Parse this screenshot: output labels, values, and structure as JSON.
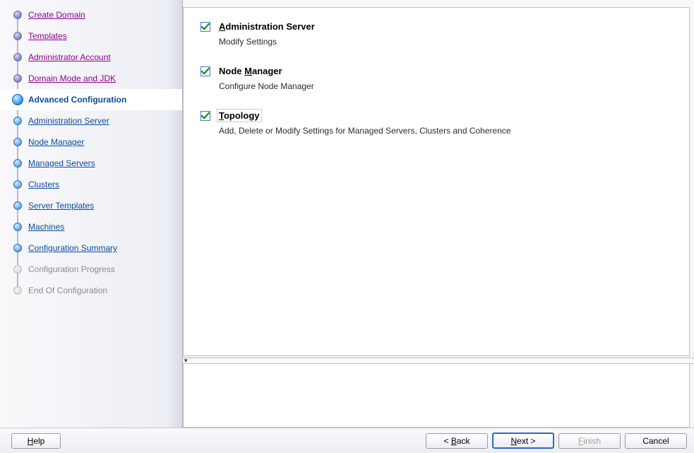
{
  "sidebar": {
    "items": [
      {
        "label": "Create Domain",
        "state": "visited",
        "interactable": true
      },
      {
        "label": "Templates",
        "state": "visited",
        "interactable": true
      },
      {
        "label": "Administrator Account",
        "state": "visited",
        "interactable": true
      },
      {
        "label": "Domain Mode and JDK",
        "state": "visited",
        "interactable": true
      },
      {
        "label": "Advanced Configuration",
        "state": "current",
        "interactable": true
      },
      {
        "label": "Administration Server",
        "state": "upcoming",
        "interactable": true
      },
      {
        "label": "Node Manager",
        "state": "upcoming",
        "interactable": true
      },
      {
        "label": "Managed Servers",
        "state": "upcoming",
        "interactable": true
      },
      {
        "label": "Clusters",
        "state": "upcoming",
        "interactable": true
      },
      {
        "label": "Server Templates",
        "state": "upcoming",
        "interactable": true
      },
      {
        "label": "Machines",
        "state": "upcoming",
        "interactable": true
      },
      {
        "label": "Configuration Summary",
        "state": "upcoming",
        "interactable": true
      },
      {
        "label": "Configuration Progress",
        "state": "future",
        "interactable": false
      },
      {
        "label": "End Of Configuration",
        "state": "future",
        "interactable": false
      }
    ]
  },
  "content": {
    "options": [
      {
        "key": "admin_server",
        "title_prefix": "A",
        "title_rest": "dministration Server",
        "desc": "Modify Settings",
        "checked": true,
        "focus": false
      },
      {
        "key": "node_manager",
        "title_prefix": "",
        "title_mid_before": "Node ",
        "title_underline": "M",
        "title_mid_after": "anager",
        "desc": "Configure Node Manager",
        "checked": true,
        "focus": false
      },
      {
        "key": "topology",
        "title_prefix": "T",
        "title_rest": "opology",
        "desc": "Add, Delete or Modify Settings for Managed Servers, Clusters and Coherence",
        "checked": true,
        "focus": true
      }
    ]
  },
  "buttons": {
    "help": {
      "underline": "H",
      "rest": "elp"
    },
    "back": {
      "prefix": "< ",
      "underline": "B",
      "rest": "ack"
    },
    "next": {
      "underline": "N",
      "rest": "ext >"
    },
    "finish": {
      "underline": "F",
      "rest": "inish",
      "disabled": true
    },
    "cancel": {
      "label": "Cancel"
    }
  }
}
